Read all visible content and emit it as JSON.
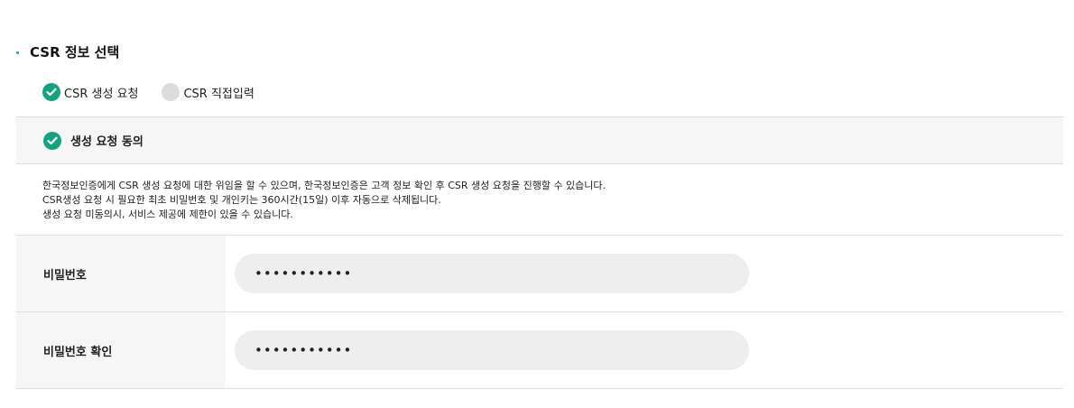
{
  "section": {
    "title": "CSR 정보 선택"
  },
  "csr_options": [
    {
      "label": "CSR 생성 요청",
      "selected": true
    },
    {
      "label": "CSR 직접입력",
      "selected": false
    }
  ],
  "agreement": {
    "label": "생성 요청 동의",
    "checked": true
  },
  "notice": {
    "lines": [
      "한국정보인증에게 CSR 생성 요청에 대한 위임을 할 수 있으며, 한국정보인증은 고객 정보 확인 후 CSR 생성 요청을 진행할 수 있습니다.",
      "CSR생성 요청 시 필요한 최초 비밀번호 및 개인키는 360시간(15일) 이후 자동으로 삭제됩니다.",
      "생성 요청 미동의시, 서비스 제공에 제한이 있을 수 있습니다."
    ]
  },
  "form": {
    "password": {
      "label": "비밀번호",
      "value": "•••••••••••"
    },
    "password_confirm": {
      "label": "비밀번호 확인",
      "value": "•••••••••••"
    }
  },
  "colors": {
    "accent": "#14a37f",
    "unselected": "#dcdcdc",
    "header_bg": "#f6f6f6",
    "input_bg": "#eeeeee"
  },
  "icons": {
    "check": "check-icon"
  }
}
